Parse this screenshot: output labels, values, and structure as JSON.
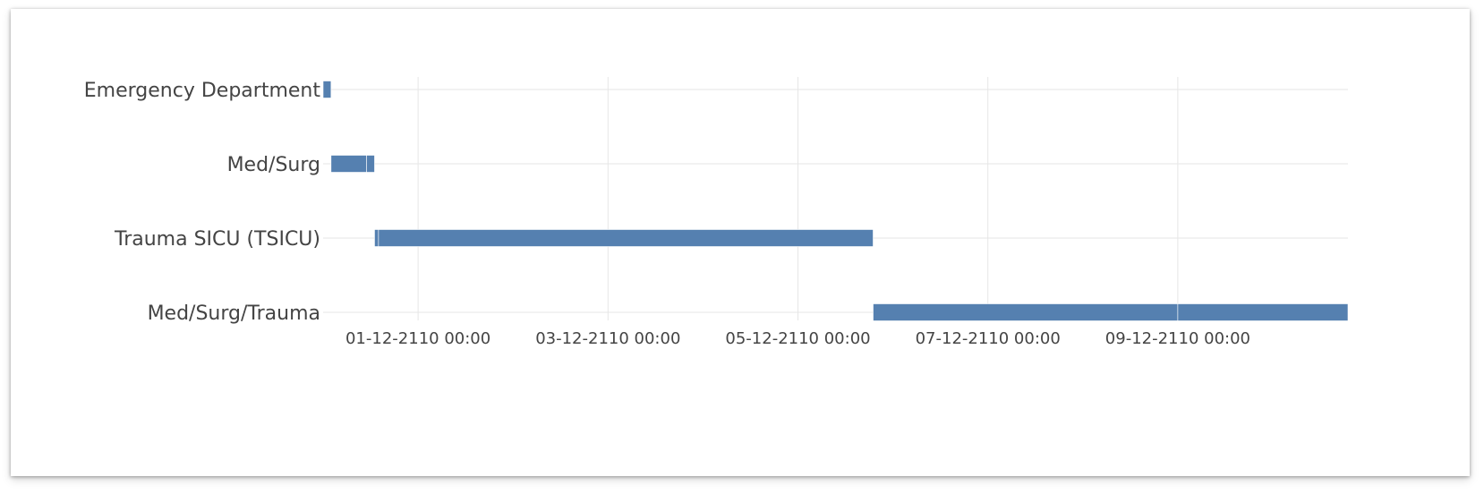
{
  "chart_data": {
    "type": "bar",
    "orientation": "horizontal",
    "subtype": "gantt",
    "title": "",
    "xlabel": "",
    "ylabel": "",
    "grid": true,
    "bar_color": "#5580b0",
    "gridline_color": "#e6e6e6",
    "text_color": "#444444",
    "x_tick_format": "DD-MM-YYYY HH:mm",
    "x_range": [
      "2110-11-29T00:00",
      "2110-12-11T00:00"
    ],
    "x_ticks": [
      "2110-12-01T00:00",
      "2110-12-03T00:00",
      "2110-12-05T00:00",
      "2110-12-07T00:00",
      "2110-12-09T00:00"
    ],
    "x_tick_labels": [
      "01-12-2110 00:00",
      "03-12-2110 00:00",
      "05-12-2110 00:00",
      "07-12-2110 00:00",
      "09-12-2110 00:00"
    ],
    "categories": [
      "Emergency Department",
      "Med/Surg",
      "Trauma SICU (TSICU)",
      "Med/Surg/Trauma"
    ],
    "segments": [
      {
        "category": "Emergency Department",
        "start": "2110-11-30T00:00",
        "end": "2110-11-30T02:00"
      },
      {
        "category": "Med/Surg",
        "start": "2110-11-30T02:00",
        "end": "2110-11-30T11:00"
      },
      {
        "category": "Med/Surg",
        "start": "2110-11-30T11:00",
        "end": "2110-11-30T13:00"
      },
      {
        "category": "Trauma SICU (TSICU)",
        "start": "2110-11-30T13:00",
        "end": "2110-11-30T14:00"
      },
      {
        "category": "Trauma SICU (TSICU)",
        "start": "2110-11-30T14:00",
        "end": "2110-12-05T19:00"
      },
      {
        "category": "Med/Surg/Trauma",
        "start": "2110-12-05T19:00",
        "end": "2110-12-09T00:00"
      },
      {
        "category": "Med/Surg/Trauma",
        "start": "2110-12-09T00:00",
        "end": "2110-12-10T19:00"
      }
    ]
  }
}
